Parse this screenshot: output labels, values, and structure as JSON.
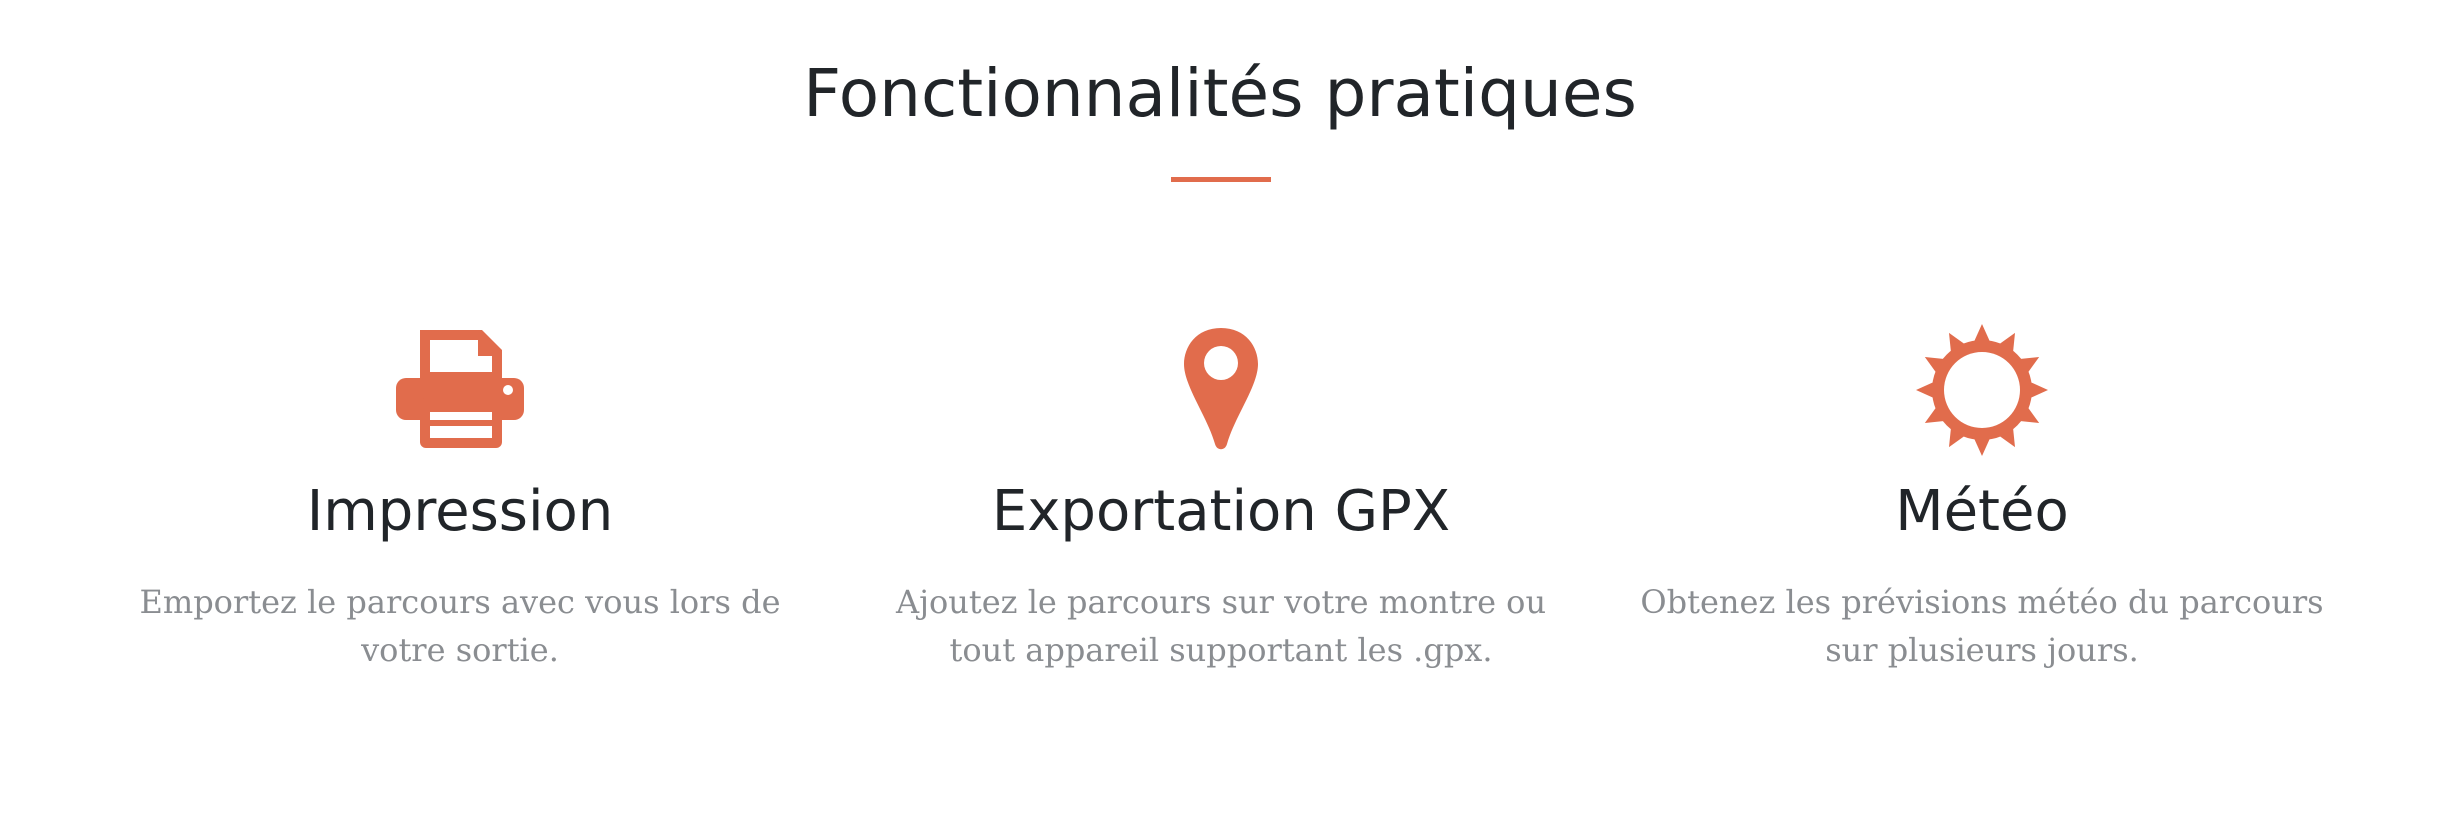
{
  "section": {
    "title": "Fonctionnalités pratiques",
    "accent_color": "#e16c4c"
  },
  "features": [
    {
      "icon": "printer-icon",
      "title": "Impression",
      "description": "Emportez le parcours avec vous lors de votre sortie."
    },
    {
      "icon": "map-marker-icon",
      "title": "Exportation GPX",
      "description": "Ajoutez le parcours sur votre montre ou tout appareil supportant les .gpx."
    },
    {
      "icon": "sun-icon",
      "title": "Météo",
      "description": "Obtenez les prévisions météo du parcours sur plusieurs jours."
    }
  ]
}
